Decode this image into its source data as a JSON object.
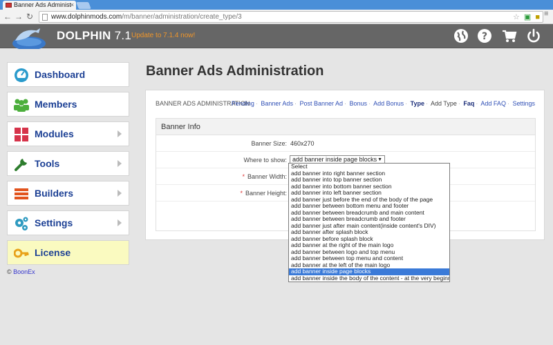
{
  "browser": {
    "tab_title": "Banner Ads Administ",
    "close": "×",
    "url_domain": "www.dolphinmods.com",
    "url_path": "/m/banner/administration/create_type/3"
  },
  "header": {
    "brand": "DOLPHIN",
    "version": "7.1",
    "update_link": "Update to 7.1.4 now!"
  },
  "sidebar": {
    "items": [
      {
        "label": "Dashboard",
        "icon": "gauge-icon"
      },
      {
        "label": "Members",
        "icon": "users-icon"
      },
      {
        "label": "Modules",
        "icon": "grid-icon"
      },
      {
        "label": "Tools",
        "icon": "wrench-icon"
      },
      {
        "label": "Builders",
        "icon": "list-icon"
      },
      {
        "label": "Settings",
        "icon": "gears-icon"
      },
      {
        "label": "License",
        "icon": "key-icon"
      }
    ],
    "copyright_symbol": "©",
    "copyright_link": "BoonEx"
  },
  "main": {
    "title": "Banner Ads Administration",
    "panel_heading": "BANNER ADS ADMINISTRATION",
    "links": [
      "Pending",
      "Banner Ads",
      "Post Banner Ad",
      "Bonus",
      "Add Bonus",
      "Type",
      "Add Type",
      "Faq",
      "Add FAQ",
      "Settings"
    ],
    "form": {
      "section": "Banner Info",
      "banner_size_label": "Banner Size:",
      "banner_size_value": "460x270",
      "where_label": "Where to show:",
      "where_value": "add banner inside page blocks",
      "width_label": "Banner Width:",
      "height_label": "Banner Height:",
      "required_mark": "*"
    },
    "dropdown_options": [
      "Select",
      "add banner into right banner section",
      "add banner into top banner section",
      "add banner into bottom banner section",
      "add banner into left banner section",
      "add banner just before the end of the body of the page",
      "add banner between bottom menu and footer",
      "add banner between breadcrumb and main content",
      "add banner between breadcrumb and footer",
      "add banner just after main content(inside content's DIV)",
      "add banner after splash block",
      "add banner before splash block",
      "add banner at the right of the main logo",
      "add banner between logo and top menu",
      "add banner between top menu and content",
      "add banner at the left of the main logo",
      "add banner inside page blocks",
      "add banner inside the body of the content - at the very beginning"
    ],
    "selected_option_index": 16
  },
  "colors": {
    "link_blue": "#2f4fb5",
    "sidebar_label": "#1b3f94",
    "update_orange": "#f0962a",
    "header_gray": "#666666",
    "selected_option": "#3a7ad8"
  }
}
